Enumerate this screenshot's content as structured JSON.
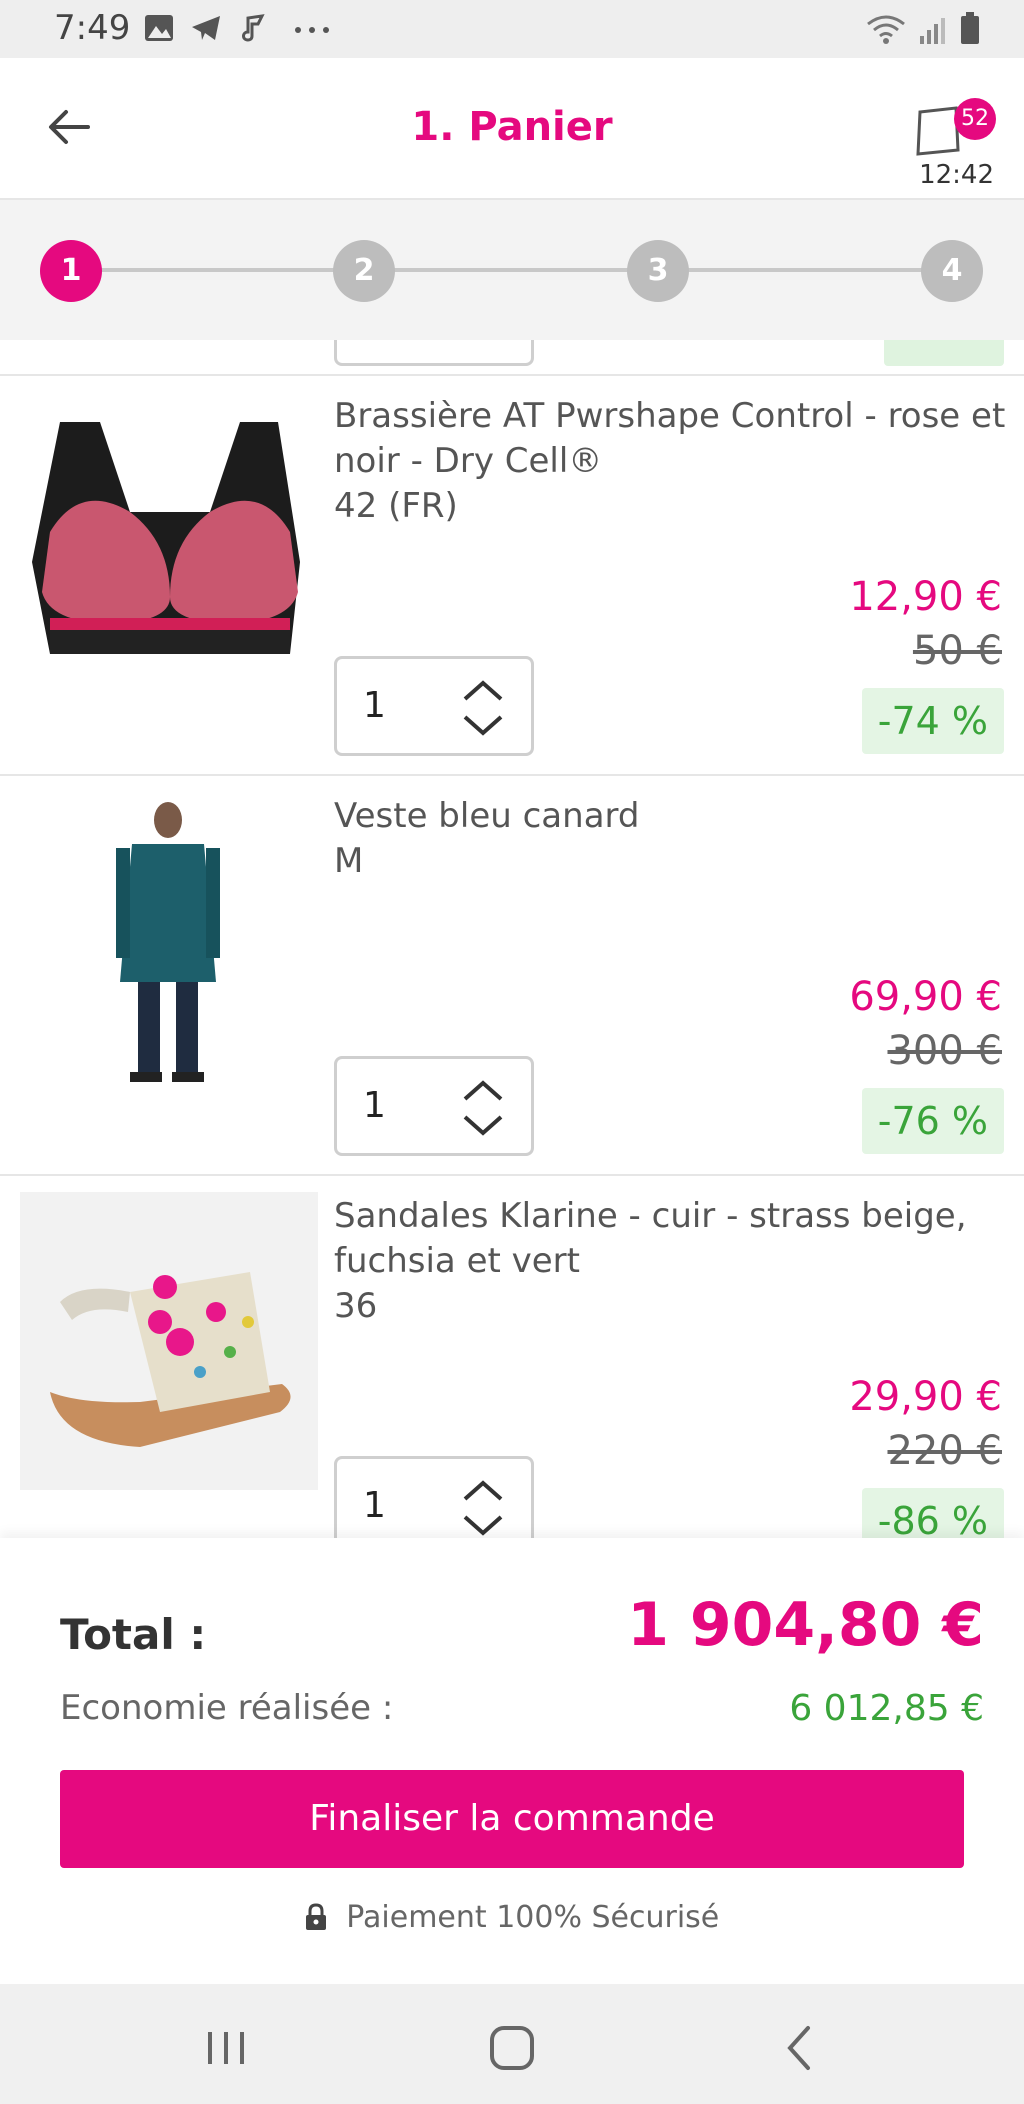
{
  "status_bar": {
    "time": "7:49",
    "left_icons": [
      "gallery-icon",
      "telegram-icon",
      "music-icon",
      "more-dots-icon"
    ],
    "right_icons": [
      "wifi-icon",
      "signal-icon",
      "battery-icon"
    ]
  },
  "header": {
    "title": "1. Panier",
    "cart_count": "52",
    "cart_timer": "12:42"
  },
  "stepper": {
    "steps": [
      "1",
      "2",
      "3",
      "4"
    ],
    "active": 0
  },
  "items": [
    {
      "name": "Brassière AT Pwrshape Control - rose et noir - Dry Cell®",
      "size": "42 (FR)",
      "quantity": "1",
      "price": "12,90 €",
      "old_price": "50 €",
      "discount": "-74 %"
    },
    {
      "name": "Veste bleu canard",
      "size": "M",
      "quantity": "1",
      "price": "69,90 €",
      "old_price": "300 €",
      "discount": "-76 %"
    },
    {
      "name": "Sandales Klarine - cuir - strass beige, fuchsia et vert",
      "size": "36",
      "quantity": "1",
      "price": "29,90 €",
      "old_price": "220 €",
      "discount": "-86 %"
    }
  ],
  "summary": {
    "total_label": "Total :",
    "total_value": "1 904,80 €",
    "savings_label": "Economie réalisée :",
    "savings_value": "6 012,85 €",
    "checkout_label": "Finaliser la commande",
    "secure_label": "Paiement 100% Sécurisé"
  },
  "colors": {
    "brand": "#e5097f",
    "savings": "#3aa43a"
  }
}
